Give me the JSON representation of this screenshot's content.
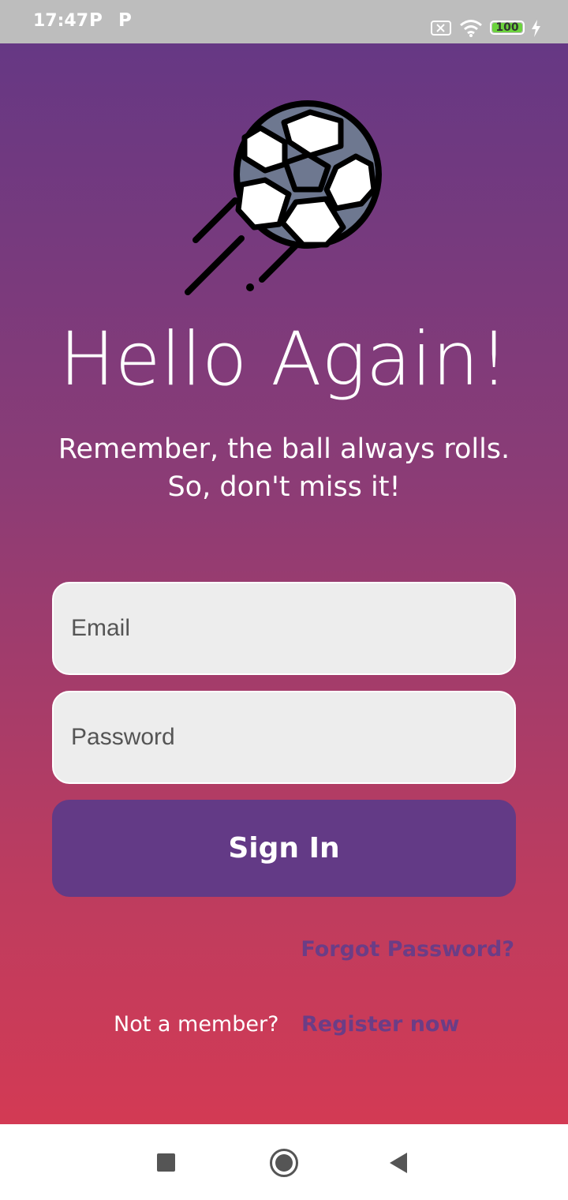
{
  "status_bar": {
    "time": "17:47",
    "app_icons": [
      "parking-icon",
      "parking-icon"
    ],
    "battery": "100",
    "icons": [
      "sim-off-icon",
      "wifi-icon",
      "battery-icon",
      "charging-bolt-icon"
    ]
  },
  "login": {
    "logo_icon": "soccer-ball-icon",
    "title": "Hello Again!",
    "subtitle_line1": "Remember, the ball always rolls.",
    "subtitle_line2": "So, don't miss it!",
    "email_placeholder": "Email",
    "password_placeholder": "Password",
    "sign_in_label": "Sign In",
    "forgot_password_label": "Forgot Password?",
    "not_member_text": "Not a member?",
    "register_label": "Register now"
  },
  "nav_bar": {
    "icons": [
      "recents-icon",
      "home-icon",
      "back-icon"
    ]
  },
  "colors": {
    "accent": "#633a86",
    "gradient_top": "#663884",
    "gradient_bottom": "#d33a54"
  }
}
